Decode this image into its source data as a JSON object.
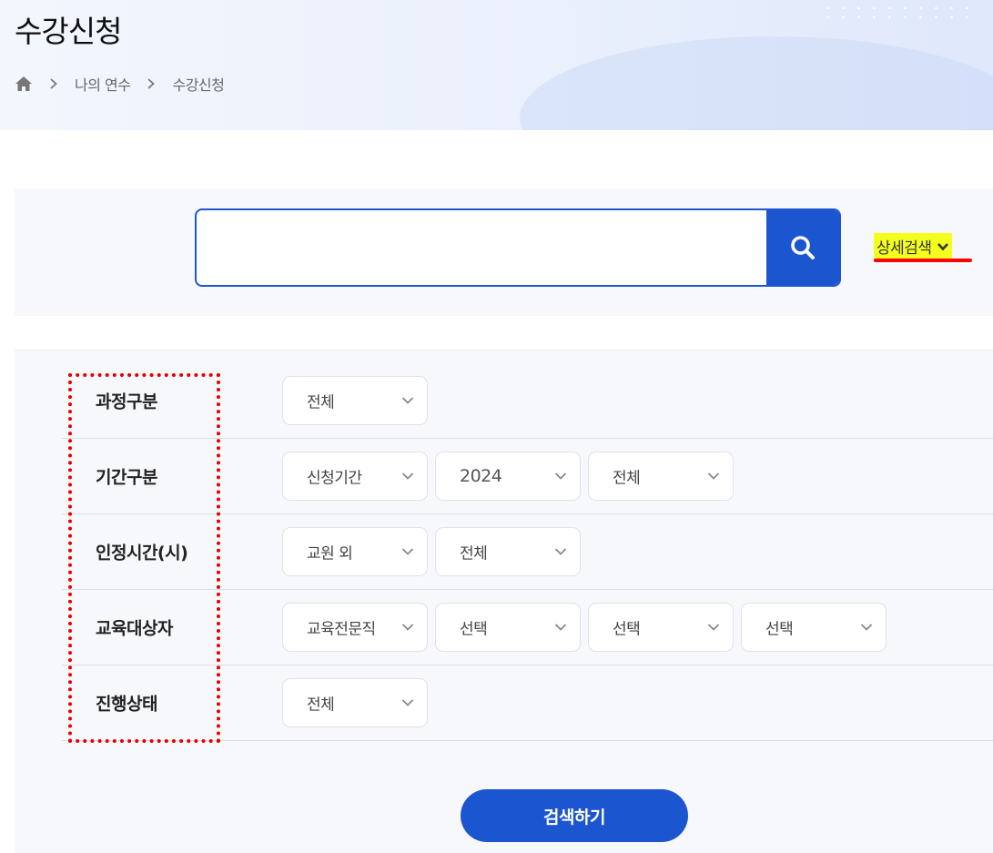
{
  "header": {
    "title": "수강신청",
    "breadcrumb": [
      "나의 연수",
      "수강신청"
    ]
  },
  "search": {
    "value": "",
    "placeholder": "",
    "detail_toggle_label": "상세검색"
  },
  "filters": {
    "rows": [
      {
        "label": "과정구분",
        "selects": [
          "전체"
        ]
      },
      {
        "label": "기간구분",
        "selects": [
          "신청기간",
          "2024",
          "전체"
        ]
      },
      {
        "label": "인정시간(시)",
        "selects": [
          "교원 외",
          "전체"
        ]
      },
      {
        "label": "교육대상자",
        "selects": [
          "교육전문직",
          "선택",
          "선택",
          "선택"
        ]
      },
      {
        "label": "진행상태",
        "selects": [
          "전체"
        ]
      }
    ],
    "submit_label": "검색하기"
  },
  "icons": {
    "home": "home-icon",
    "separator": "chevron-right-icon",
    "search": "search-icon",
    "toggle": "chevron-down-icon",
    "select": "chevron-down-icon"
  },
  "colors": {
    "primary": "#1b55d0",
    "highlight": "#f4ff1e",
    "annotation": "#e50000",
    "panel_bg": "#f7f8fb"
  }
}
